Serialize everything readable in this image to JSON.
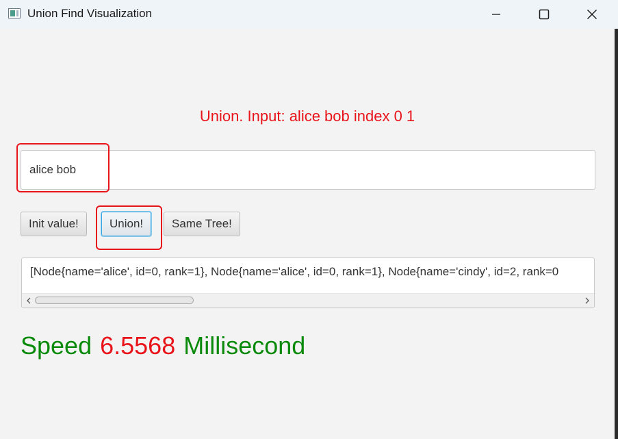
{
  "window": {
    "title": "Union Find Visualization",
    "icon": "app-window-icon",
    "controls": [
      "minimize-icon",
      "maximize-icon",
      "close-icon"
    ]
  },
  "banner": {
    "text": "Union. Input: alice bob index 0 1",
    "color": "#e8141a"
  },
  "input": {
    "value": "alice bob",
    "placeholder": ""
  },
  "buttons": {
    "init_label": "Init value!",
    "union_label": "Union!",
    "same_tree_label": "Same Tree!"
  },
  "output": {
    "text": "[Node{name='alice', id=0, rank=1}, Node{name='alice', id=0, rank=1}, Node{name='cindy', id=2, rank=0"
  },
  "speed": {
    "label": "Speed",
    "value": "6.5568",
    "unit": "Millisecond",
    "label_color": "#0a8a0a",
    "value_color": "#e8141a"
  },
  "colors": {
    "highlight": "#e8141a",
    "focus": "#3aa8e0"
  }
}
